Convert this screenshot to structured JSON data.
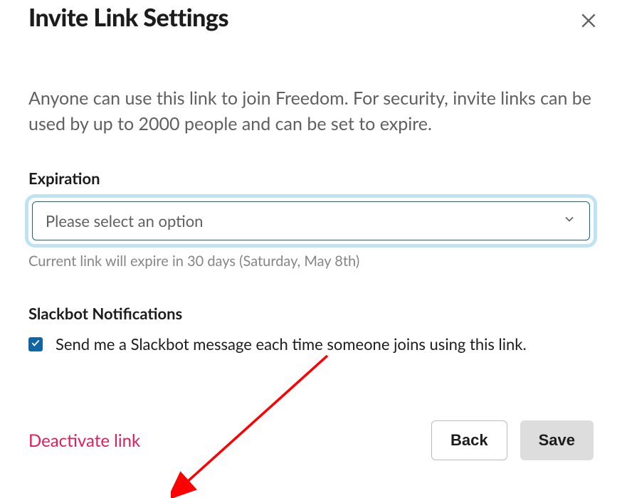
{
  "modal": {
    "title": "Invite Link Settings",
    "description": "Anyone can use this link to join Freedom. For security, invite links can be used by up to 2000 people and can be set to expire.",
    "expiration": {
      "label": "Expiration",
      "placeholder": "Please select an option",
      "helper": "Current link will expire in 30 days (Saturday, May 8th)"
    },
    "notifications": {
      "label": "Slackbot Notifications",
      "checkbox_checked": true,
      "checkbox_label": "Send me a Slackbot message each time someone joins using this link."
    },
    "footer": {
      "deactivate": "Deactivate link",
      "back": "Back",
      "save": "Save"
    }
  }
}
